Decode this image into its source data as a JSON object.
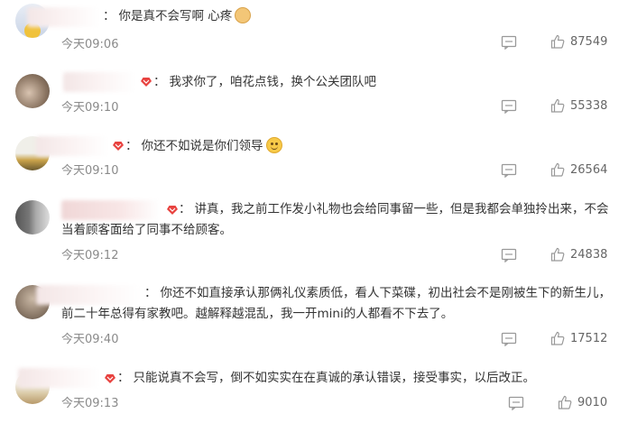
{
  "comments": [
    {
      "separator": "：",
      "text": "你是真不会写啊 心疼",
      "emoji": "doge-icon",
      "time": "今天09:06",
      "likes": "87549"
    },
    {
      "separator": "：",
      "text": "我求你了，咱花点钱，换个公关团队吧",
      "time": "今天09:10",
      "likes": "55338"
    },
    {
      "separator": "：",
      "text": "你还不如说是你们领导",
      "emoji": "smile-icon",
      "time": "今天09:10",
      "likes": "26564"
    },
    {
      "separator": "：",
      "text": "讲真，我之前工作发小礼物也会给同事留一些，但是我都会单独拎出来，不会当着顾客面给了同事不给顾客。",
      "time": "今天09:12",
      "likes": "24838"
    },
    {
      "separator": "：",
      "text": "你还不如直接承认那俩礼仪素质低，看人下菜碟，初出社会不是刚被生下的新生儿，前二十年总得有家教吧。越解释越混乱，我一开mini的人都看不下去了。",
      "time": "今天09:40",
      "likes": "17512"
    },
    {
      "separator": "：",
      "text": "只能说真不会写，倒不如实实在在真诚的承认错误，接受事实，以后改正。",
      "time": "今天09:13",
      "likes": "9010"
    }
  ],
  "colors": {
    "text": "#333333",
    "time": "#8a8a8a",
    "badge": "#e8423f",
    "icon": "#999999"
  }
}
